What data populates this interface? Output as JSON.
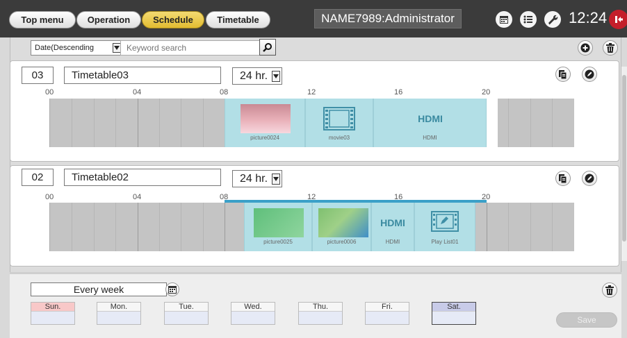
{
  "nav": {
    "tabs": [
      {
        "label": "Top menu",
        "active": false
      },
      {
        "label": "Operation",
        "active": false
      },
      {
        "label": "Schedule",
        "active": true
      },
      {
        "label": "Timetable",
        "active": false
      }
    ],
    "user": "NAME7989:Administrator",
    "clock": "12:24",
    "icons": [
      "calendar-icon",
      "list-icon",
      "wrench-icon",
      "logout-icon"
    ]
  },
  "toolbar": {
    "sort_value": "Date(Descending",
    "search_placeholder": "Keyword search",
    "icons": [
      "search-icon",
      "add-icon",
      "trash-icon"
    ]
  },
  "timeline_ticks": [
    "00",
    "04",
    "08",
    "12",
    "16",
    "20"
  ],
  "timetables": [
    {
      "number": "03",
      "name": "Timetable03",
      "hours": "24 hr.",
      "items": [
        {
          "label": "picture0024",
          "kind": "picture",
          "start_hour": 8.0,
          "end_hour": 11.7
        },
        {
          "label": "movie03",
          "kind": "movie",
          "start_hour": 11.7,
          "end_hour": 14.8
        },
        {
          "label": "HDMI",
          "kind": "hdmi",
          "start_hour": 14.8,
          "end_hour": 20.0
        }
      ]
    },
    {
      "number": "02",
      "name": "Timetable02",
      "hours": "24 hr.",
      "items": [
        {
          "label": "picture0025",
          "kind": "picture",
          "start_hour": 8.9,
          "end_hour": 12.0
        },
        {
          "label": "picture0006",
          "kind": "picture",
          "start_hour": 12.0,
          "end_hour": 14.7
        },
        {
          "label": "HDMI",
          "kind": "hdmi",
          "start_hour": 14.7,
          "end_hour": 16.7
        },
        {
          "label": "Play List01",
          "kind": "playlist",
          "start_hour": 16.7,
          "end_hour": 19.5
        }
      ]
    }
  ],
  "repeat": "Every week",
  "days": [
    {
      "label": "Sun.",
      "selected": false
    },
    {
      "label": "Mon.",
      "selected": false
    },
    {
      "label": "Tue.",
      "selected": false
    },
    {
      "label": "Wed.",
      "selected": false
    },
    {
      "label": "Thu.",
      "selected": false
    },
    {
      "label": "Fri.",
      "selected": false
    },
    {
      "label": "Sat.",
      "selected": true
    }
  ],
  "save_label": "Save",
  "colors": {
    "accent": "#e2bc31",
    "item_fill": "#b2dfe6",
    "logout": "#c41e2a"
  }
}
